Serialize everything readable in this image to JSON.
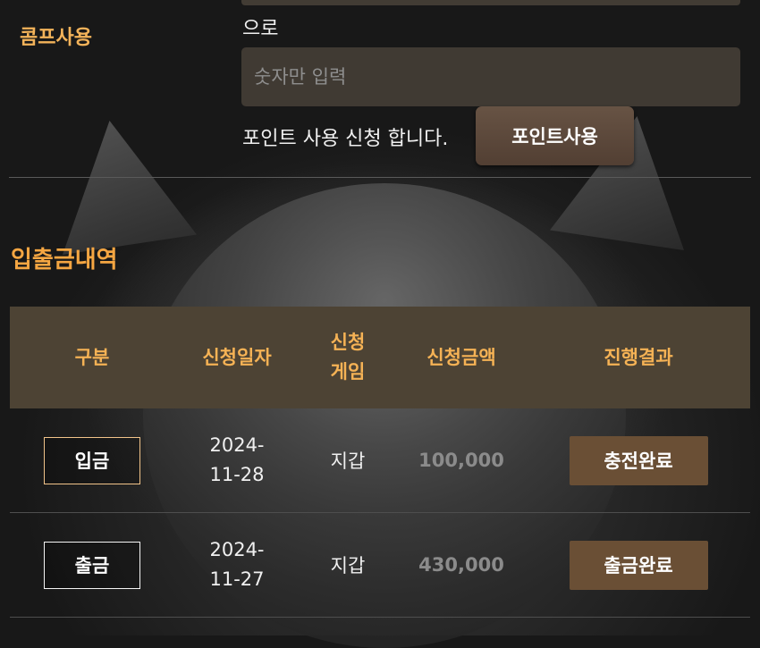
{
  "comp": {
    "label": "콤프사용",
    "unit_text": "으로",
    "input_placeholder": "숫자만 입력",
    "request_text": "포인트 사용 신청 합니다.",
    "button_label": "포인트사용"
  },
  "history": {
    "title": "입출금내역",
    "headers": {
      "type": "구분",
      "date": "신청일자",
      "game_line1": "신청",
      "game_line2": "게임",
      "amount": "신청금액",
      "status": "진행결과"
    },
    "rows": [
      {
        "type": "입금",
        "date_line1": "2024-",
        "date_line2": "11-28",
        "game": "지갑",
        "amount": "100,000",
        "status": "충전완료"
      },
      {
        "type": "출금",
        "date_line1": "2024-",
        "date_line2": "11-27",
        "game": "지갑",
        "amount": "430,000",
        "status": "출금완료"
      }
    ]
  },
  "colors": {
    "accent": "#f5a642",
    "header_bg": "#4d4334",
    "status_button": "#6a4f35",
    "input_bg": "#403a33"
  }
}
